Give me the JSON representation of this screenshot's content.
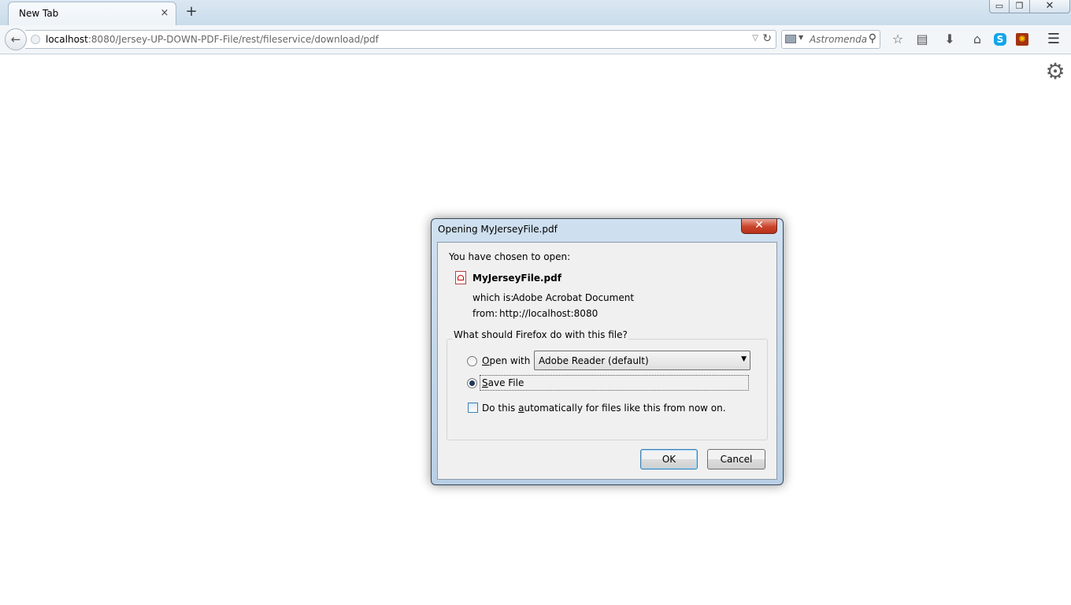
{
  "browser": {
    "tab_title": "New Tab",
    "tab_close": "×",
    "new_tab": "+",
    "url_host": "localhost",
    "url_rest": ":8080/Jersey-UP-DOWN-PDF-File/rest/fileservice/download/pdf",
    "search_engine": "Astromenda",
    "window_controls": {
      "minimize": "▭",
      "restore": "❐",
      "close": "✕"
    },
    "toolbar_icons": [
      "star-icon",
      "reading-list-icon",
      "download-icon",
      "home-icon",
      "skype-icon",
      "extension-icon",
      "menu-icon"
    ]
  },
  "page": {
    "gear_glyph": "⚙"
  },
  "dialog": {
    "title": "Opening MyJerseyFile.pdf",
    "close_glyph": "✕",
    "intro": "You have chosen to open:",
    "file_name": "MyJerseyFile.pdf",
    "which_is_label": "which is:",
    "which_is_value": "Adobe Acrobat Document",
    "from_label": "from:",
    "from_value": "http://localhost:8080",
    "group_label": "What should Firefox do with this file?",
    "open_with_label": "Open with",
    "open_with_app": "Adobe Reader  (default)",
    "save_file_label": "Save File",
    "selected_action": "save",
    "auto_label": "Do this automatically for files like this from now on.",
    "auto_checked": false,
    "ok_label": "OK",
    "cancel_label": "Cancel"
  }
}
